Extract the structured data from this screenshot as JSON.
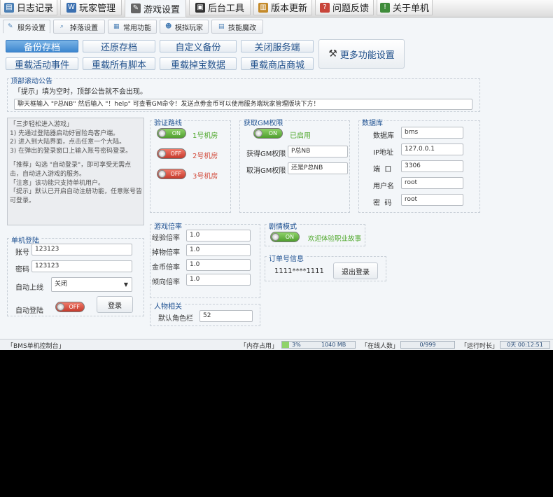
{
  "top_tabs": [
    {
      "label": "日志记录",
      "icon": "log-icon",
      "color": "#4a7fb5"
    },
    {
      "label": "玩家管理",
      "icon": "player-icon",
      "color": "#3a6fb0"
    },
    {
      "label": "游戏设置",
      "icon": "game-settings-icon",
      "color": "#555555"
    },
    {
      "label": "后台工具",
      "icon": "tools-icon",
      "color": "#333333"
    },
    {
      "label": "版本更新",
      "icon": "update-icon",
      "color": "#c48a2a"
    },
    {
      "label": "问题反馈",
      "icon": "feedback-icon",
      "color": "#c8453a"
    },
    {
      "label": "关于单机",
      "icon": "about-icon",
      "color": "#3f8c3a"
    }
  ],
  "sub_tabs": [
    {
      "label": "服务设置"
    },
    {
      "label": "掉落设置"
    },
    {
      "label": "常用功能"
    },
    {
      "label": "模拟玩家"
    },
    {
      "label": "技能魔改"
    }
  ],
  "actions": {
    "backup": "备份存档",
    "restore": "还原存档",
    "custom_backup": "自定义备份",
    "stop_server": "关闭服务端",
    "reload_events": "重载活动事件",
    "reload_scripts": "重载所有脚本",
    "reload_drops": "重载掉宝数据",
    "reload_shop": "重载商店商城",
    "more": "更多功能设置"
  },
  "notice": {
    "title": "顶部滚动公告",
    "hint": "「提示」填为空时，顶部公告就不会出现。",
    "value": "聊天框输入 \"P总NB\" 然后输入 \"！help\" 可查看GM命令！发送点劵金币可以使用服务端玩家管理版块下方！"
  },
  "guide": {
    "lines": [
      "「三步轻松进入游戏」",
      "1) 先通过登陆器启动好冒险岛客户端。",
      "2) 进入到大陆界面，点击任意一个大陆。",
      "3) 在弹出的登录窗口上输入账号密码登录。",
      "",
      "「推荐」勾选 \"自动登录\"，即可享受无需点击，自动进入游戏的服务。",
      "「注意」该功能只支持单机用户。",
      "「提示」默认已开启自动注册功能，任意账号皆可登录。"
    ]
  },
  "route": {
    "title": "验证路线",
    "items": [
      {
        "state": "ON",
        "label": "1号机房"
      },
      {
        "state": "OFF",
        "label": "2号机房"
      },
      {
        "state": "OFF",
        "label": "3号机房"
      }
    ]
  },
  "gm": {
    "title": "获取GM权限",
    "toggle": "ON",
    "status": "已启用",
    "get_label": "获得GM权限",
    "get_value": "P总NB",
    "cancel_label": "取消GM权限",
    "cancel_value": "还是P总NB"
  },
  "database": {
    "title": "数据库",
    "fields": [
      {
        "label": "数据库",
        "value": "bms"
      },
      {
        "label": "IP地址",
        "value": "127.0.0.1"
      },
      {
        "label": "端  口",
        "value": "3306"
      },
      {
        "label": "用户名",
        "value": "root"
      },
      {
        "label": "密  码",
        "value": "root"
      }
    ]
  },
  "login": {
    "title": "单机登陆",
    "account_label": "账号",
    "account_value": "123123",
    "password_label": "密码",
    "password_value": "123123",
    "auto_online_label": "自动上线",
    "auto_online_value": "关闭",
    "auto_login_label": "自动登陆",
    "auto_login_state": "OFF",
    "login_button": "登录"
  },
  "rates": {
    "title": "游戏倍率",
    "fields": [
      {
        "label": "经验倍率",
        "value": "1.0"
      },
      {
        "label": "掉物倍率",
        "value": "1.0"
      },
      {
        "label": "金币倍率",
        "value": "1.0"
      },
      {
        "label": "倾向倍率",
        "value": "1.0"
      }
    ]
  },
  "story": {
    "title": "剧情模式",
    "toggle": "ON",
    "label": "欢迎体验职业故事"
  },
  "order": {
    "title": "订单号信息",
    "value": "1111****1111",
    "logout": "退出登录"
  },
  "character": {
    "title": "人物相关",
    "slots_label": "默认角色栏",
    "slots_value": "52"
  },
  "status": {
    "app": "「BMS单机控制台」",
    "memory_label": "「内存占用」",
    "memory_percent": "3%",
    "memory_value": "1040 MB",
    "online_label": "「在线人数」",
    "online_value": "0/999",
    "uptime_label": "「运行时长」",
    "uptime_value": "0天 00:12:51"
  },
  "colors": {
    "accent": "#3d87cf",
    "title": "#1a4d8f",
    "on": "#4fa82c",
    "off": "#d24b3c"
  }
}
